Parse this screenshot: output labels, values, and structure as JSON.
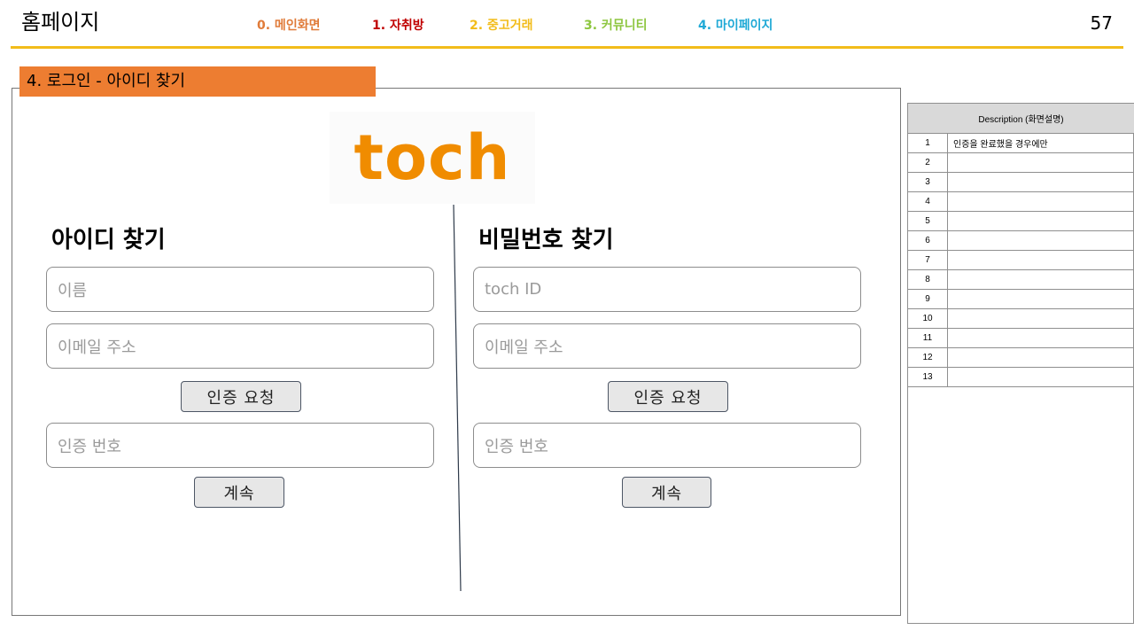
{
  "header": {
    "title": "홈페이지",
    "page_number": "57",
    "nav": [
      {
        "label": "0. 메인화면",
        "color": "#e07b39"
      },
      {
        "label": "1. 자취방",
        "color": "#c00000"
      },
      {
        "label": "2. 중고거래",
        "color": "#f2bc1a"
      },
      {
        "label": "3. 커뮤니티",
        "color": "#8dc63f"
      },
      {
        "label": "4. 마이페이지",
        "color": "#1fa9d6"
      }
    ],
    "rule_color": "#f2bc1a"
  },
  "section": {
    "label": "4. 로그인 - 아이디 찾기",
    "color": "#ed7d31"
  },
  "logo": {
    "text": "toch",
    "color": "#f08c00"
  },
  "find_id": {
    "title": "아이디 찾기",
    "name_placeholder": "이름",
    "email_placeholder": "이메일 주소",
    "request_button": "인증 요청",
    "code_placeholder": "인증 번호",
    "continue_button": "계속"
  },
  "find_password": {
    "title": "비밀번호 찾기",
    "id_placeholder": "toch ID",
    "email_placeholder": "이메일 주소",
    "request_button": "인증 요청",
    "code_placeholder": "인증 번호",
    "continue_button": "계속"
  },
  "description": {
    "header": "Description (화면설명)",
    "rows": [
      {
        "num": "1",
        "text": "인증을 완료했을 경우에만"
      },
      {
        "num": "2",
        "text": ""
      },
      {
        "num": "3",
        "text": ""
      },
      {
        "num": "4",
        "text": ""
      },
      {
        "num": "5",
        "text": ""
      },
      {
        "num": "6",
        "text": ""
      },
      {
        "num": "7",
        "text": ""
      },
      {
        "num": "8",
        "text": ""
      },
      {
        "num": "9",
        "text": ""
      },
      {
        "num": "10",
        "text": ""
      },
      {
        "num": "11",
        "text": ""
      },
      {
        "num": "12",
        "text": ""
      },
      {
        "num": "13",
        "text": ""
      }
    ]
  }
}
